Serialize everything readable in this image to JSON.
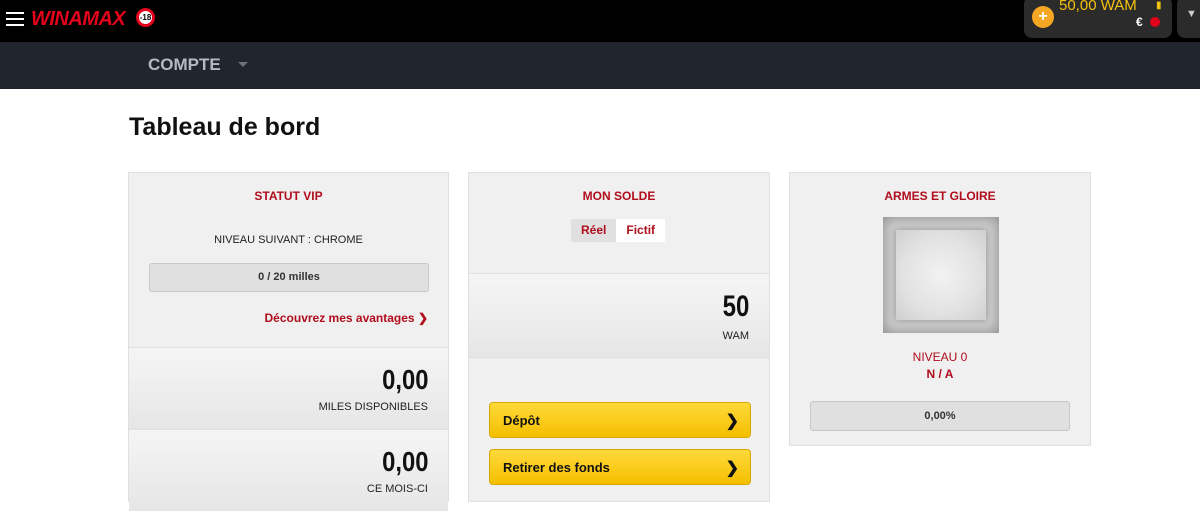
{
  "header": {
    "logo": "WINAMAX",
    "age_badge": "-18",
    "wallet_amount": "50,00 WAM",
    "wallet_currency": "€"
  },
  "subnav": {
    "title": "COMPTE"
  },
  "page_title": "Tableau de bord",
  "vip": {
    "title": "STATUT VIP",
    "next_level": "NIVEAU SUIVANT : CHROME",
    "progress": "0 / 20 milles",
    "progress_value": 0,
    "link": "Découvrez mes avantages",
    "available_value": "0,00",
    "available_label": "MILES DISPONIBLES",
    "month_value": "0,00",
    "month_label": "CE MOIS-CI"
  },
  "solde": {
    "title": "MON SOLDE",
    "toggle_real": "Réel",
    "toggle_fictif": "Fictif",
    "active_toggle": "Fictif",
    "balance_value": "50",
    "balance_unit": "WAM",
    "deposit_label": "Dépôt",
    "withdraw_label": "Retirer des fonds"
  },
  "armes": {
    "title": "ARMES ET GLOIRE",
    "level": "NIVEAU 0",
    "rank": "N / A",
    "progress": "0,00%",
    "progress_value": 0
  },
  "colors": {
    "brand_red": "#e3031b",
    "title_red": "#b00d1d",
    "button_yellow": "#f5bf00",
    "topbar": "#000000",
    "subnav": "#21252e"
  }
}
